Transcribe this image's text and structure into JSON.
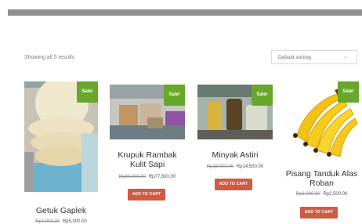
{
  "shop": {
    "results_text": "Showing all 5 results",
    "sort_label": "Default sorting"
  },
  "products": [
    {
      "name": "Getuk Gaplek",
      "old_price": "Rp7,000.00",
      "new_price": "Rp5,000.00",
      "sale_label": "Sale!"
    },
    {
      "name_line1": "Krupuk Rambak",
      "name_line2": "Kulit Sapi",
      "old_price": "Rp80,000.00",
      "new_price": "Rp77,500.00",
      "sale_label": "Sale!",
      "button_label": "ADD TO CART"
    },
    {
      "name": "Minyak Astiri",
      "old_price": "Rp15,000.00",
      "new_price": "Rp14,500.00",
      "sale_label": "Sale!",
      "button_label": "ADD TO CART"
    },
    {
      "name_line1": "Pisang Tanduk Alas",
      "name_line2": "Roban",
      "old_price": "Rp3,000.00",
      "new_price": "Rp2,500.00",
      "sale_label": "Sale!",
      "button_label": "ADD TO CART"
    }
  ],
  "colors": {
    "sale_badge": "#68a729",
    "cart_button": "#d05b42",
    "top_strip": "#8f8f8f"
  }
}
